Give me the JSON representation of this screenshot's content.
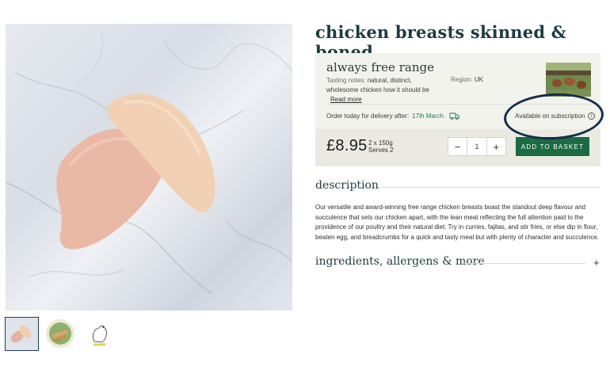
{
  "product": {
    "title": "chicken breasts skinned & boned"
  },
  "gallery": {
    "thumbnails": [
      "chicken-breasts-thumb",
      "chicken-salad-thumb",
      "chicken-illustration-thumb"
    ]
  },
  "info": {
    "range_title": "always free range",
    "tasting_label": "Tasting notes:",
    "tasting_text": "natural, distinct, wholesome chicken how it should be",
    "read_more": "Read more",
    "region_label": "Region:",
    "region_value": "UK",
    "delivery_label": "Order today for delivery after:",
    "delivery_date": "17th March",
    "subscription_text": "Available on subscription",
    "info_icon": "i"
  },
  "purchase": {
    "price": "£8.95",
    "pack_line1": "2 x 150g",
    "pack_line2": "Serves 2",
    "minus": "−",
    "quantity": "1",
    "plus": "+",
    "add_to_basket": "ADD TO BASKET"
  },
  "description": {
    "heading": "description",
    "text": "Our versatile and award-winning free range chicken breasts boast the standout deep flavour and succulence that sets our chicken apart, with the lean meat reflecting the full attention paid to the providence of our poultry and their natural diet. Try in curries, fajitas, and stir fries, or else dip in flour, beaten egg, and breadcrumbs for a quick and tasty meal but with plenty of character and succulence."
  },
  "ingredients": {
    "heading": "ingredients, allergens & more",
    "expand": "+"
  },
  "colors": {
    "accent_green": "#1d6b45",
    "title_teal": "#1c3b3f",
    "panel_bg": "#f3f3ee",
    "annotation_ring": "#152c4d"
  }
}
